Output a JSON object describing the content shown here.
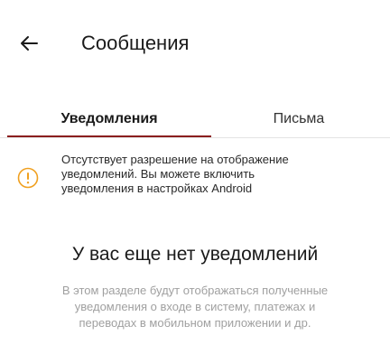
{
  "header": {
    "back_icon": "arrow-left-icon",
    "title": "Сообщения"
  },
  "tabs": [
    {
      "label": "Уведомления",
      "active": true
    },
    {
      "label": "Письма",
      "active": false
    }
  ],
  "colors": {
    "accent": "#8b1e1e",
    "warning": "#f0a020"
  },
  "notice": {
    "icon": "warning-icon",
    "lines": [
      "Отсутствует разрешение на отображение",
      "уведомлений. Вы можете включить",
      "уведомления в настройках Android"
    ]
  },
  "empty_state": {
    "title": "У вас еще нет уведомлений",
    "description_lines": [
      "В этом разделе будут отображаться полученные",
      "уведомления о входе в систему, платежах и",
      "переводах в мобильном приложении и др."
    ]
  }
}
